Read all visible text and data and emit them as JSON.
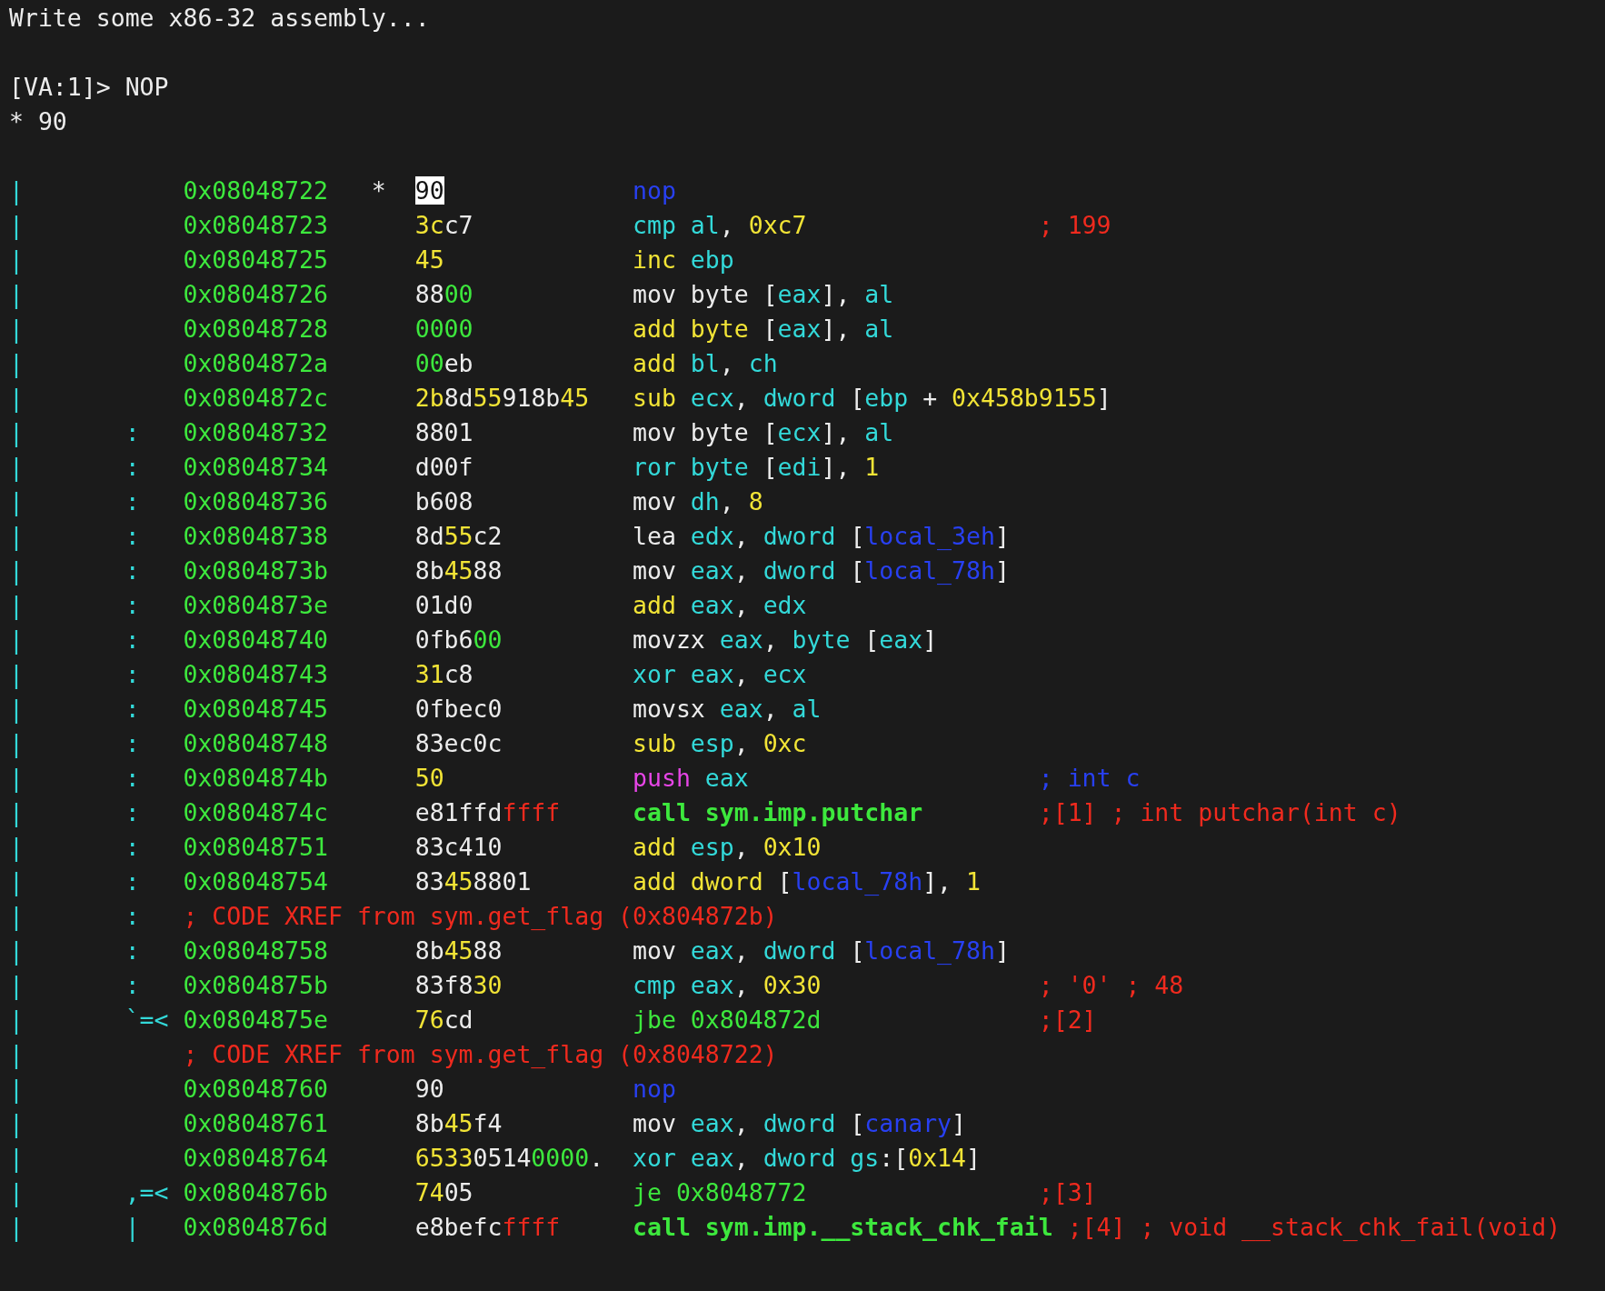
{
  "header": {
    "message": "Write some x86-32 assembly...",
    "prompt": "[VA:1]>",
    "input": "NOP",
    "result": "* 90"
  },
  "rows": [
    {
      "kind": "instruction",
      "gutter": "|",
      "address": "0x08048722",
      "marker": "*",
      "selected": true,
      "bytes": [
        {
          "kind": "plain",
          "text": "90"
        }
      ],
      "instruction": [
        {
          "kind": "nop",
          "text": "nop"
        }
      ]
    },
    {
      "kind": "instruction",
      "gutter": "|",
      "address": "0x08048723",
      "selected": false,
      "bytes": [
        {
          "kind": "ascii",
          "text": "3c"
        },
        {
          "kind": "plain",
          "text": "c7"
        }
      ],
      "instruction": [
        {
          "kind": "reg",
          "text": "cmp al"
        },
        {
          "kind": "text",
          "text": ", "
        },
        {
          "kind": "num",
          "text": "0xc7"
        }
      ],
      "comment": {
        "kind": "note",
        "text": "; 199"
      }
    },
    {
      "kind": "instruction",
      "gutter": "|",
      "address": "0x08048725",
      "selected": false,
      "bytes": [
        {
          "kind": "ascii",
          "text": "45"
        }
      ],
      "instruction": [
        {
          "kind": "arith",
          "text": "inc "
        },
        {
          "kind": "reg",
          "text": "ebp"
        }
      ]
    },
    {
      "kind": "instruction",
      "gutter": "|",
      "address": "0x08048726",
      "selected": false,
      "bytes": [
        {
          "kind": "plain",
          "text": "88"
        },
        {
          "kind": "zero",
          "text": "00"
        }
      ],
      "instruction": [
        {
          "kind": "text",
          "text": "mov byte ["
        },
        {
          "kind": "reg",
          "text": "eax"
        },
        {
          "kind": "text",
          "text": "], "
        },
        {
          "kind": "reg",
          "text": "al"
        }
      ]
    },
    {
      "kind": "instruction",
      "gutter": "|",
      "address": "0x08048728",
      "selected": false,
      "bytes": [
        {
          "kind": "zero",
          "text": "0000"
        }
      ],
      "instruction": [
        {
          "kind": "arith",
          "text": "add byte"
        },
        {
          "kind": "text",
          "text": " ["
        },
        {
          "kind": "reg",
          "text": "eax"
        },
        {
          "kind": "text",
          "text": "], "
        },
        {
          "kind": "reg",
          "text": "al"
        }
      ]
    },
    {
      "kind": "instruction",
      "gutter": "|",
      "address": "0x0804872a",
      "selected": false,
      "bytes": [
        {
          "kind": "zero",
          "text": "00"
        },
        {
          "kind": "plain",
          "text": "eb"
        }
      ],
      "instruction": [
        {
          "kind": "arith",
          "text": "add "
        },
        {
          "kind": "reg",
          "text": "bl"
        },
        {
          "kind": "text",
          "text": ", "
        },
        {
          "kind": "reg",
          "text": "ch"
        }
      ]
    },
    {
      "kind": "instruction",
      "gutter": "|",
      "address": "0x0804872c",
      "selected": false,
      "bytes": [
        {
          "kind": "ascii",
          "text": "2b"
        },
        {
          "kind": "plain",
          "text": "8d"
        },
        {
          "kind": "ascii",
          "text": "55"
        },
        {
          "kind": "plain",
          "text": "918b"
        },
        {
          "kind": "ascii",
          "text": "45"
        }
      ],
      "instruction": [
        {
          "kind": "arith",
          "text": "sub "
        },
        {
          "kind": "reg",
          "text": "ecx"
        },
        {
          "kind": "text",
          "text": ", "
        },
        {
          "kind": "reg",
          "text": "dword"
        },
        {
          "kind": "text",
          "text": " ["
        },
        {
          "kind": "reg",
          "text": "ebp"
        },
        {
          "kind": "text",
          "text": " + "
        },
        {
          "kind": "num",
          "text": "0x458b9155"
        },
        {
          "kind": "text",
          "text": "]"
        }
      ]
    },
    {
      "kind": "instruction",
      "gutter": "|",
      "graph": ":",
      "address": "0x08048732",
      "selected": false,
      "bytes": [
        {
          "kind": "plain",
          "text": "8801"
        }
      ],
      "instruction": [
        {
          "kind": "text",
          "text": "mov byte ["
        },
        {
          "kind": "reg",
          "text": "ecx"
        },
        {
          "kind": "text",
          "text": "], "
        },
        {
          "kind": "reg",
          "text": "al"
        }
      ]
    },
    {
      "kind": "instruction",
      "gutter": "|",
      "graph": ":",
      "address": "0x08048734",
      "selected": false,
      "bytes": [
        {
          "kind": "plain",
          "text": "d00f"
        }
      ],
      "instruction": [
        {
          "kind": "reg",
          "text": "ror byte"
        },
        {
          "kind": "text",
          "text": " ["
        },
        {
          "kind": "reg",
          "text": "edi"
        },
        {
          "kind": "text",
          "text": "], "
        },
        {
          "kind": "num",
          "text": "1"
        }
      ]
    },
    {
      "kind": "instruction",
      "gutter": "|",
      "graph": ":",
      "address": "0x08048736",
      "selected": false,
      "bytes": [
        {
          "kind": "plain",
          "text": "b608"
        }
      ],
      "instruction": [
        {
          "kind": "text",
          "text": "mov "
        },
        {
          "kind": "reg",
          "text": "dh"
        },
        {
          "kind": "text",
          "text": ", "
        },
        {
          "kind": "num",
          "text": "8"
        }
      ]
    },
    {
      "kind": "instruction",
      "gutter": "|",
      "graph": ":",
      "address": "0x08048738",
      "selected": false,
      "bytes": [
        {
          "kind": "plain",
          "text": "8d"
        },
        {
          "kind": "ascii",
          "text": "55"
        },
        {
          "kind": "plain",
          "text": "c2"
        }
      ],
      "instruction": [
        {
          "kind": "text",
          "text": "lea "
        },
        {
          "kind": "reg",
          "text": "edx"
        },
        {
          "kind": "text",
          "text": ", "
        },
        {
          "kind": "reg",
          "text": "dword"
        },
        {
          "kind": "text",
          "text": " ["
        },
        {
          "kind": "var",
          "text": "local_3eh"
        },
        {
          "kind": "text",
          "text": "]"
        }
      ]
    },
    {
      "kind": "instruction",
      "gutter": "|",
      "graph": ":",
      "address": "0x0804873b",
      "selected": false,
      "bytes": [
        {
          "kind": "plain",
          "text": "8b"
        },
        {
          "kind": "ascii",
          "text": "45"
        },
        {
          "kind": "plain",
          "text": "88"
        }
      ],
      "instruction": [
        {
          "kind": "text",
          "text": "mov "
        },
        {
          "kind": "reg",
          "text": "eax"
        },
        {
          "kind": "text",
          "text": ", "
        },
        {
          "kind": "reg",
          "text": "dword"
        },
        {
          "kind": "text",
          "text": " ["
        },
        {
          "kind": "var",
          "text": "local_78h"
        },
        {
          "kind": "text",
          "text": "]"
        }
      ]
    },
    {
      "kind": "instruction",
      "gutter": "|",
      "graph": ":",
      "address": "0x0804873e",
      "selected": false,
      "bytes": [
        {
          "kind": "plain",
          "text": "01d0"
        }
      ],
      "instruction": [
        {
          "kind": "arith",
          "text": "add "
        },
        {
          "kind": "reg",
          "text": "eax"
        },
        {
          "kind": "text",
          "text": ", "
        },
        {
          "kind": "reg",
          "text": "edx"
        }
      ]
    },
    {
      "kind": "instruction",
      "gutter": "|",
      "graph": ":",
      "address": "0x08048740",
      "selected": false,
      "bytes": [
        {
          "kind": "plain",
          "text": "0fb6"
        },
        {
          "kind": "zero",
          "text": "00"
        }
      ],
      "instruction": [
        {
          "kind": "text",
          "text": "movzx "
        },
        {
          "kind": "reg",
          "text": "eax"
        },
        {
          "kind": "text",
          "text": ", "
        },
        {
          "kind": "reg",
          "text": "byte"
        },
        {
          "kind": "text",
          "text": " ["
        },
        {
          "kind": "reg",
          "text": "eax"
        },
        {
          "kind": "text",
          "text": "]"
        }
      ]
    },
    {
      "kind": "instruction",
      "gutter": "|",
      "graph": ":",
      "address": "0x08048743",
      "selected": false,
      "bytes": [
        {
          "kind": "ascii",
          "text": "31"
        },
        {
          "kind": "plain",
          "text": "c8"
        }
      ],
      "instruction": [
        {
          "kind": "reg",
          "text": "xor eax"
        },
        {
          "kind": "text",
          "text": ", "
        },
        {
          "kind": "reg",
          "text": "ecx"
        }
      ]
    },
    {
      "kind": "instruction",
      "gutter": "|",
      "graph": ":",
      "address": "0x08048745",
      "selected": false,
      "bytes": [
        {
          "kind": "plain",
          "text": "0fbec0"
        }
      ],
      "instruction": [
        {
          "kind": "text",
          "text": "movsx "
        },
        {
          "kind": "reg",
          "text": "eax"
        },
        {
          "kind": "text",
          "text": ", "
        },
        {
          "kind": "reg",
          "text": "al"
        }
      ]
    },
    {
      "kind": "instruction",
      "gutter": "|",
      "graph": ":",
      "address": "0x08048748",
      "selected": false,
      "bytes": [
        {
          "kind": "plain",
          "text": "83ec0c"
        }
      ],
      "instruction": [
        {
          "kind": "arith",
          "text": "sub "
        },
        {
          "kind": "reg",
          "text": "esp"
        },
        {
          "kind": "text",
          "text": ", "
        },
        {
          "kind": "num",
          "text": "0xc"
        }
      ]
    },
    {
      "kind": "instruction",
      "gutter": "|",
      "graph": ":",
      "address": "0x0804874b",
      "selected": false,
      "bytes": [
        {
          "kind": "ascii",
          "text": "50"
        }
      ],
      "instruction": [
        {
          "kind": "push",
          "text": "push "
        },
        {
          "kind": "reg",
          "text": "eax"
        }
      ],
      "comment": {
        "kind": "arg",
        "text": "; int c"
      }
    },
    {
      "kind": "instruction",
      "gutter": "|",
      "graph": ":",
      "address": "0x0804874c",
      "selected": false,
      "bytes": [
        {
          "kind": "plain",
          "text": "e81ffd"
        },
        {
          "kind": "ff",
          "text": "ffff"
        }
      ],
      "instruction": [
        {
          "kind": "call",
          "text": "call sym.imp.putchar"
        }
      ],
      "comment": {
        "kind": "note",
        "text": ";[1] ; int putchar(int c)"
      }
    },
    {
      "kind": "instruction",
      "gutter": "|",
      "graph": ":",
      "address": "0x08048751",
      "selected": false,
      "bytes": [
        {
          "kind": "plain",
          "text": "83c410"
        }
      ],
      "instruction": [
        {
          "kind": "arith",
          "text": "add "
        },
        {
          "kind": "reg",
          "text": "esp"
        },
        {
          "kind": "text",
          "text": ", "
        },
        {
          "kind": "num",
          "text": "0x10"
        }
      ]
    },
    {
      "kind": "instruction",
      "gutter": "|",
      "graph": ":",
      "address": "0x08048754",
      "selected": false,
      "bytes": [
        {
          "kind": "plain",
          "text": "83"
        },
        {
          "kind": "ascii",
          "text": "45"
        },
        {
          "kind": "plain",
          "text": "8801"
        }
      ],
      "instruction": [
        {
          "kind": "arith",
          "text": "add dword"
        },
        {
          "kind": "text",
          "text": " ["
        },
        {
          "kind": "var",
          "text": "local_78h"
        },
        {
          "kind": "text",
          "text": "], "
        },
        {
          "kind": "num",
          "text": "1"
        }
      ]
    },
    {
      "kind": "xref",
      "gutter": "|",
      "graph": ":",
      "text": "; CODE XREF from sym.get_flag (0x804872b)"
    },
    {
      "kind": "instruction",
      "gutter": "|",
      "graph": ":",
      "address": "0x08048758",
      "selected": false,
      "bytes": [
        {
          "kind": "plain",
          "text": "8b"
        },
        {
          "kind": "ascii",
          "text": "45"
        },
        {
          "kind": "plain",
          "text": "88"
        }
      ],
      "instruction": [
        {
          "kind": "text",
          "text": "mov "
        },
        {
          "kind": "reg",
          "text": "eax"
        },
        {
          "kind": "text",
          "text": ", "
        },
        {
          "kind": "reg",
          "text": "dword"
        },
        {
          "kind": "text",
          "text": " ["
        },
        {
          "kind": "var",
          "text": "local_78h"
        },
        {
          "kind": "text",
          "text": "]"
        }
      ]
    },
    {
      "kind": "instruction",
      "gutter": "|",
      "graph": ":",
      "address": "0x0804875b",
      "selected": false,
      "bytes": [
        {
          "kind": "plain",
          "text": "83f8"
        },
        {
          "kind": "ascii",
          "text": "30"
        }
      ],
      "instruction": [
        {
          "kind": "reg",
          "text": "cmp eax"
        },
        {
          "kind": "text",
          "text": ", "
        },
        {
          "kind": "num",
          "text": "0x30"
        }
      ],
      "comment": {
        "kind": "note",
        "text": "; '0' ; 48"
      }
    },
    {
      "kind": "instruction",
      "gutter": "|",
      "graph": "`=<",
      "address": "0x0804875e",
      "selected": false,
      "bytes": [
        {
          "kind": "ascii",
          "text": "76"
        },
        {
          "kind": "plain",
          "text": "cd"
        }
      ],
      "instruction": [
        {
          "kind": "jump",
          "text": "jbe 0x804872d"
        }
      ],
      "comment": {
        "kind": "note",
        "text": ";[2]"
      }
    },
    {
      "kind": "xref",
      "gutter": "|",
      "text": "; CODE XREF from sym.get_flag (0x8048722)"
    },
    {
      "kind": "instruction",
      "gutter": "|",
      "address": "0x08048760",
      "selected": false,
      "bytes": [
        {
          "kind": "plain",
          "text": "90"
        }
      ],
      "instruction": [
        {
          "kind": "nop",
          "text": "nop"
        }
      ]
    },
    {
      "kind": "instruction",
      "gutter": "|",
      "address": "0x08048761",
      "selected": false,
      "bytes": [
        {
          "kind": "plain",
          "text": "8b"
        },
        {
          "kind": "ascii",
          "text": "45"
        },
        {
          "kind": "plain",
          "text": "f4"
        }
      ],
      "instruction": [
        {
          "kind": "text",
          "text": "mov "
        },
        {
          "kind": "reg",
          "text": "eax"
        },
        {
          "kind": "text",
          "text": ", "
        },
        {
          "kind": "reg",
          "text": "dword"
        },
        {
          "kind": "text",
          "text": " ["
        },
        {
          "kind": "var",
          "text": "canary"
        },
        {
          "kind": "text",
          "text": "]"
        }
      ]
    },
    {
      "kind": "instruction",
      "gutter": "|",
      "address": "0x08048764",
      "selected": false,
      "bytes": [
        {
          "kind": "ascii",
          "text": "6533"
        },
        {
          "kind": "plain",
          "text": "0514"
        },
        {
          "kind": "zero",
          "text": "0000"
        },
        {
          "kind": "plain",
          "text": "."
        }
      ],
      "instruction": [
        {
          "kind": "reg",
          "text": "xor eax"
        },
        {
          "kind": "text",
          "text": ", "
        },
        {
          "kind": "reg",
          "text": "dword gs"
        },
        {
          "kind": "text",
          "text": ":["
        },
        {
          "kind": "num",
          "text": "0x14"
        },
        {
          "kind": "text",
          "text": "]"
        }
      ]
    },
    {
      "kind": "instruction",
      "gutter": "|",
      "graph": ",=<",
      "address": "0x0804876b",
      "selected": false,
      "bytes": [
        {
          "kind": "ascii",
          "text": "74"
        },
        {
          "kind": "plain",
          "text": "05"
        }
      ],
      "instruction": [
        {
          "kind": "jump",
          "text": "je 0x8048772"
        }
      ],
      "comment": {
        "kind": "note",
        "text": ";[3]"
      }
    },
    {
      "kind": "instruction",
      "gutter": "|",
      "graph": "|",
      "address": "0x0804876d",
      "selected": false,
      "bytes": [
        {
          "kind": "plain",
          "text": "e8befc"
        },
        {
          "kind": "ff",
          "text": "ffff"
        }
      ],
      "instruction": [
        {
          "kind": "call",
          "text": "call sym.imp.__stack_chk_fail"
        }
      ],
      "comment": {
        "kind": "note",
        "text": ";[4] ; void __stack_chk_fail(void)"
      }
    }
  ]
}
